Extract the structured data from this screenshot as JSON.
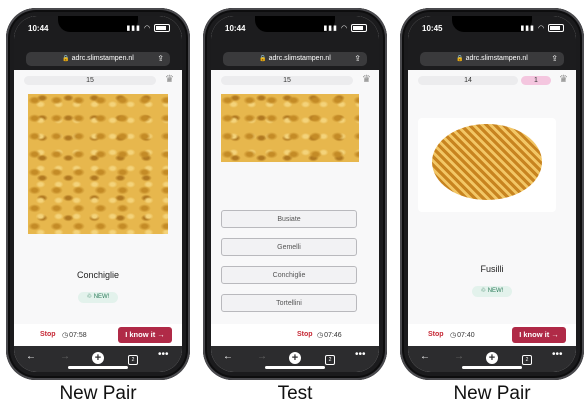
{
  "url": "adrc.slimstampen.nl",
  "phones": [
    {
      "time": "10:44",
      "progress": "15",
      "word": "Conchiglie",
      "new_label": "NEW!",
      "stop": "Stop",
      "timer": "07:58",
      "iknow": "I know it",
      "caption": "New Pair"
    },
    {
      "time": "10:44",
      "progress": "15",
      "options": [
        "Busiate",
        "Gemelli",
        "Conchiglie",
        "Tortellini"
      ],
      "stop": "Stop",
      "timer": "07:46",
      "caption": "Test"
    },
    {
      "time": "10:45",
      "progress": "14",
      "badge": "1",
      "word": "Fusilli",
      "new_label": "NEW!",
      "stop": "Stop",
      "timer": "07:40",
      "iknow": "I know it",
      "caption": "New Pair"
    }
  ],
  "icons": {
    "lock": "lock-icon",
    "share": "share-icon",
    "crown": "crown-icon",
    "back": "back-arrow-icon",
    "forward": "forward-arrow-icon",
    "plus": "plus-icon",
    "tabs": "tabs-icon",
    "more": "more-icon"
  },
  "tabs_count": "2",
  "colors": {
    "accent": "#b02a47",
    "stop": "#c62835",
    "badge": "#f4c6df",
    "new_tag": "#e3f2ec"
  }
}
